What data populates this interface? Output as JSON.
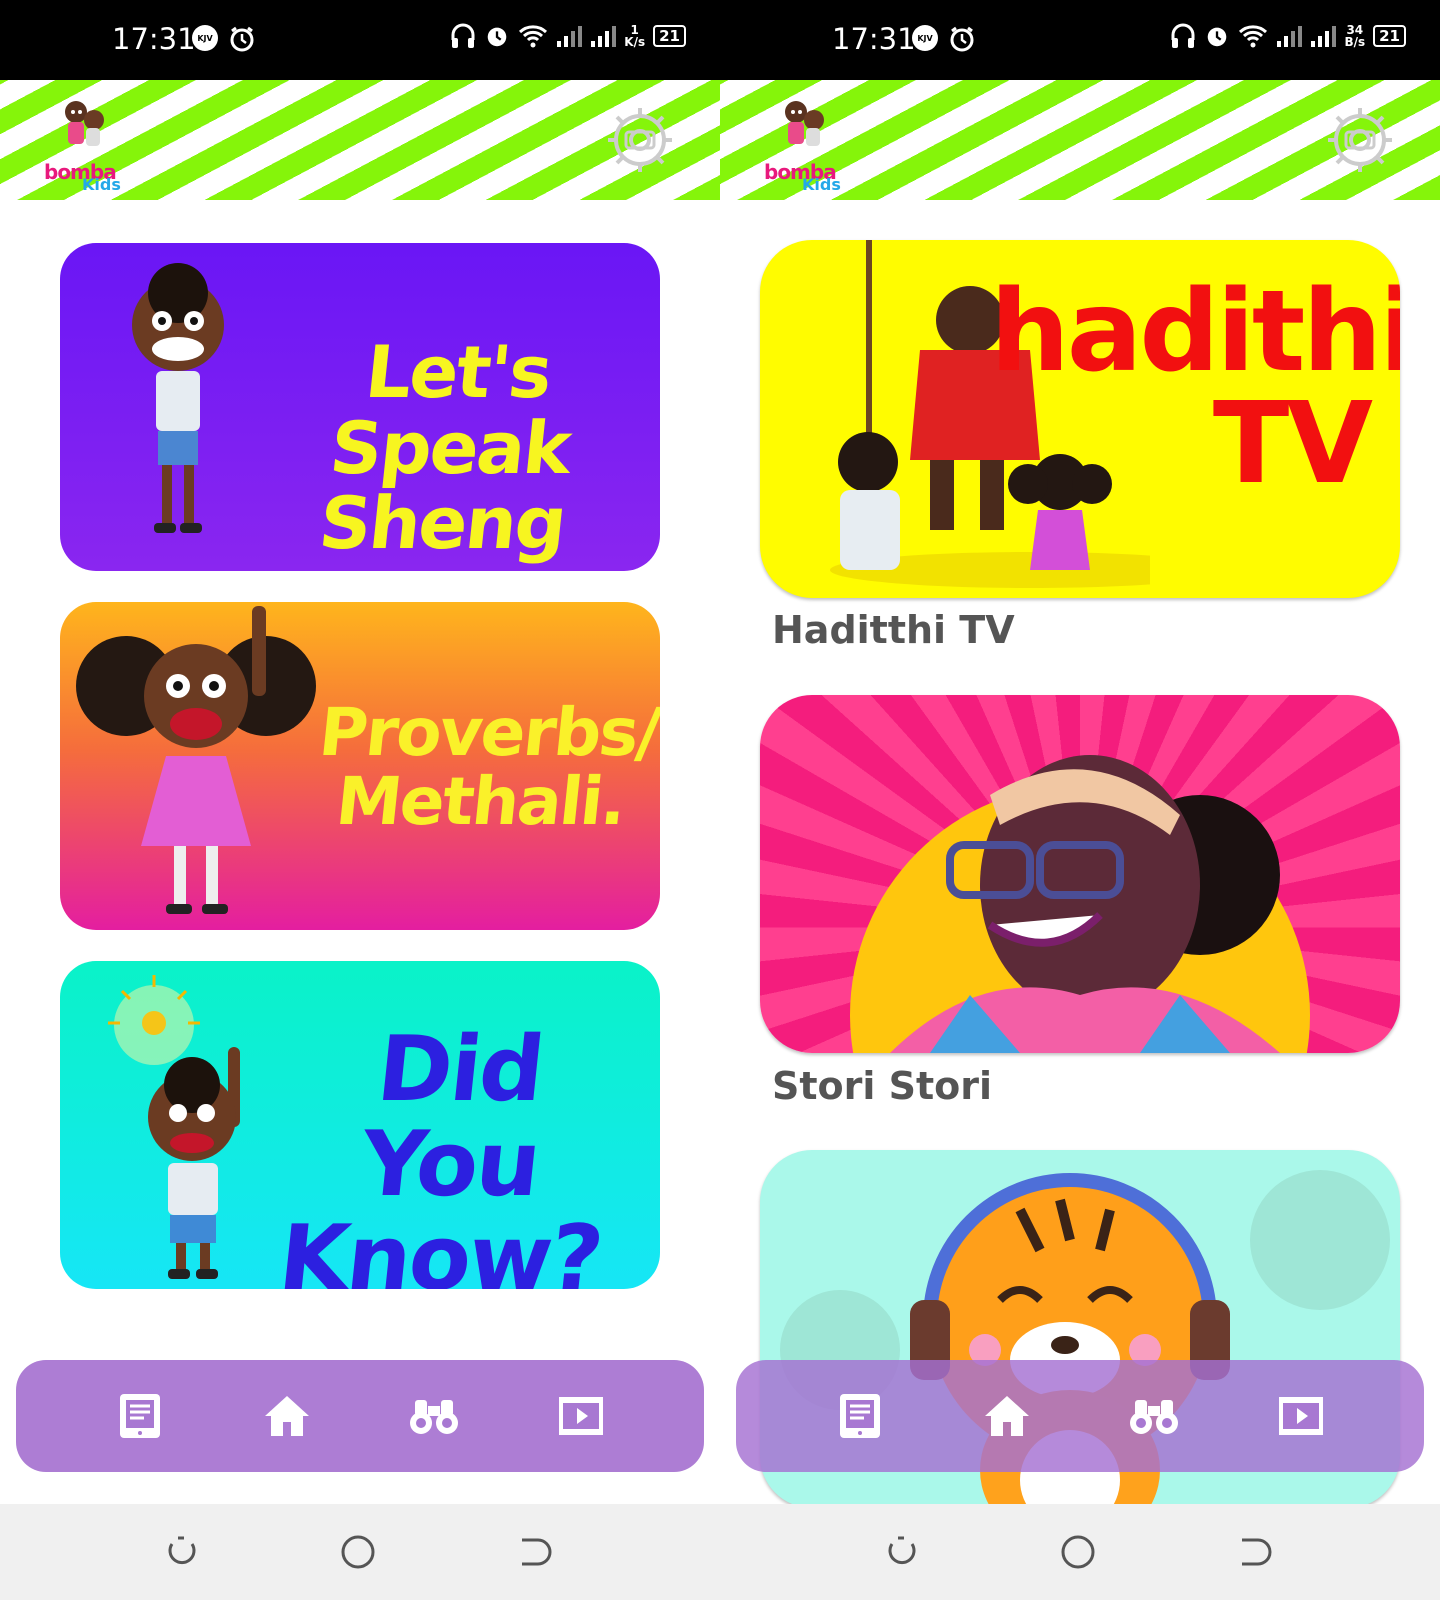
{
  "status": {
    "time": "17:31",
    "kjv": "KJV",
    "left_rate": [
      "1",
      "K/s"
    ],
    "right_rate": [
      "34",
      "B/s"
    ],
    "battery": "21"
  },
  "logo": {
    "line1": "bomba",
    "line2": "Kids"
  },
  "left_screen": {
    "cards": [
      {
        "title_line1": "Let's Speak",
        "title_line2": "Sheng"
      },
      {
        "title_line1": "Proverbs/",
        "title_line2": "Methali."
      },
      {
        "title_line1": "Did You",
        "title_line2": "Know?"
      }
    ]
  },
  "right_screen": {
    "cards": [
      {
        "art_title_line1": "hadithi",
        "art_title_line2": "TV",
        "label": "Haditthi TV"
      },
      {
        "label": "Stori Stori"
      },
      {
        "label": ""
      }
    ]
  },
  "colors": {
    "accent_green": "#85f50a",
    "nav_purple": "#aa78d2",
    "label_gray": "#555555"
  },
  "icons": [
    "gear-icon",
    "book-icon",
    "home-icon",
    "binoculars-icon",
    "video-icon",
    "recent-apps-icon",
    "home-circle-icon",
    "back-icon"
  ]
}
